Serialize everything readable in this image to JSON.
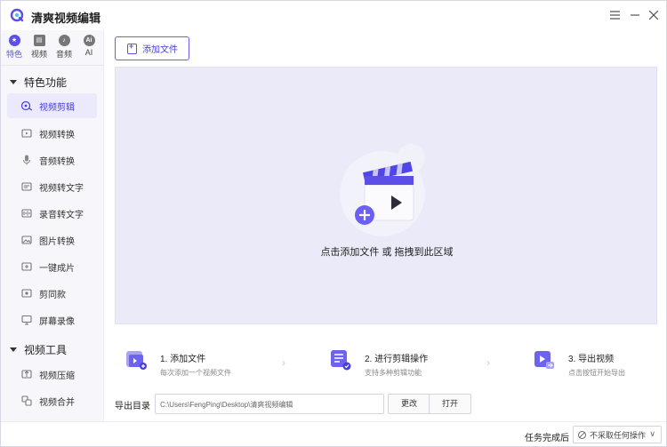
{
  "app": {
    "title": "清爽视频编辑"
  },
  "window_controls": [
    "menu-icon",
    "minimize-icon",
    "close-icon"
  ],
  "category_tabs": [
    {
      "label": "特色",
      "icon": "star-icon",
      "active": true
    },
    {
      "label": "视频",
      "icon": "film-icon",
      "active": false
    },
    {
      "label": "音频",
      "icon": "audio-icon",
      "active": false
    },
    {
      "label": "AI",
      "icon": "ai-icon",
      "active": false
    }
  ],
  "groups": [
    {
      "label": "特色功能"
    },
    {
      "label": "视频工具"
    }
  ],
  "nav_items": [
    {
      "label": "视频剪辑",
      "icon": "video-edit-icon",
      "active": true
    },
    {
      "label": "视频转换",
      "icon": "video-convert-icon"
    },
    {
      "label": "音频转换",
      "icon": "microphone-icon"
    },
    {
      "label": "视频转文字",
      "icon": "video-to-text-icon"
    },
    {
      "label": "录音转文字",
      "icon": "audio-to-text-icon"
    },
    {
      "label": "图片转换",
      "icon": "image-icon"
    },
    {
      "label": "一键成片",
      "icon": "one-click-icon"
    },
    {
      "label": "剪同款",
      "icon": "template-icon"
    },
    {
      "label": "屏幕录像",
      "icon": "screen-record-icon"
    },
    {
      "label": "视频压缩",
      "icon": "compress-icon"
    },
    {
      "label": "视频合并",
      "icon": "merge-icon"
    }
  ],
  "main": {
    "add_file_button": "添加文件",
    "drop_text": "点击添加文件 或 拖拽到此区域"
  },
  "steps": [
    {
      "title": "1. 添加文件",
      "subtitle": "每次添加一个视频文件"
    },
    {
      "title": "2. 进行剪辑操作",
      "subtitle": "支持多种剪辑功能"
    },
    {
      "title": "3. 导出视频",
      "subtitle": "点击按钮开始导出"
    }
  ],
  "export": {
    "label": "导出目录",
    "path": "C:\\Users\\FengPing\\Desktop\\清爽视频编辑",
    "change_button": "更改",
    "open_button": "打开"
  },
  "footer": {
    "after_task_label": "任务完成后",
    "after_task_value": "不采取任何操作"
  },
  "colors": {
    "accent": "#5b4fe8",
    "dropzone_bg": "#eaeaf8",
    "active_nav_bg": "#ebe9fc"
  }
}
